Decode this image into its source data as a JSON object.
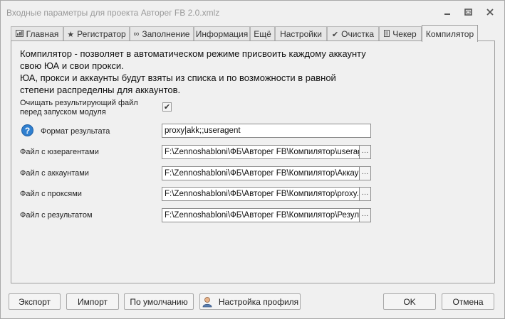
{
  "window": {
    "title": "Входные параметры для проекта Авторег FB 2.0.xmlz"
  },
  "tabs": [
    {
      "label": "Главная",
      "icon": "dashboard-icon"
    },
    {
      "label": "Регистратор",
      "icon": "star-icon"
    },
    {
      "label": "Заполнение",
      "icon": "infinity-icon"
    },
    {
      "label": "Информация",
      "icon": ""
    },
    {
      "label": "Ещё",
      "icon": ""
    },
    {
      "label": "Настройки",
      "icon": ""
    },
    {
      "label": "Очистка",
      "icon": "check-icon"
    },
    {
      "label": "Чекер",
      "icon": "document-icon"
    },
    {
      "label": "Компилятор",
      "icon": ""
    }
  ],
  "active_tab": "Компилятор",
  "description": [
    "Компилятор - позволяет в автоматическом режиме присвоить каждому аккаунту",
    "свою  ЮА и свои прокси.",
    "ЮА, прокси и аккаунты будут взяты из списка и по возможности в равной",
    "степени распределны для аккаунтов."
  ],
  "clear_result": {
    "label_line1": "Очищать результирующий файл",
    "label_line2": "перед запуском модуля",
    "checked": true
  },
  "form": {
    "format_label": "Формат результата",
    "format_value": "proxy|akk;;useragent",
    "useragents_label": "Файл с юзерагентами",
    "useragents_value": "F:\\Zennoshabloni\\ФБ\\Авторег FB\\Компилятор\\userage",
    "accounts_label": "Файл с аккаунтами",
    "accounts_value": "F:\\Zennoshabloni\\ФБ\\Авторег FB\\Компилятор\\Аккаун",
    "proxies_label": "Файл с проксями",
    "proxies_value": "F:\\Zennoshabloni\\ФБ\\Авторег FB\\Компилятор\\proxy.tx",
    "result_label": "Файл с результатом",
    "result_value": "F:\\Zennoshabloni\\ФБ\\Авторег FB\\Компилятор\\Результ",
    "browse_label": "···"
  },
  "buttons": {
    "export": "Экспорт",
    "import": "Импорт",
    "default": "По умолчанию",
    "profile": "Настройка профиля",
    "ok": "OK",
    "cancel": "Отмена"
  },
  "colors": {
    "help_icon": "#2f7fcf",
    "window_bg": "#f0f0f0"
  }
}
